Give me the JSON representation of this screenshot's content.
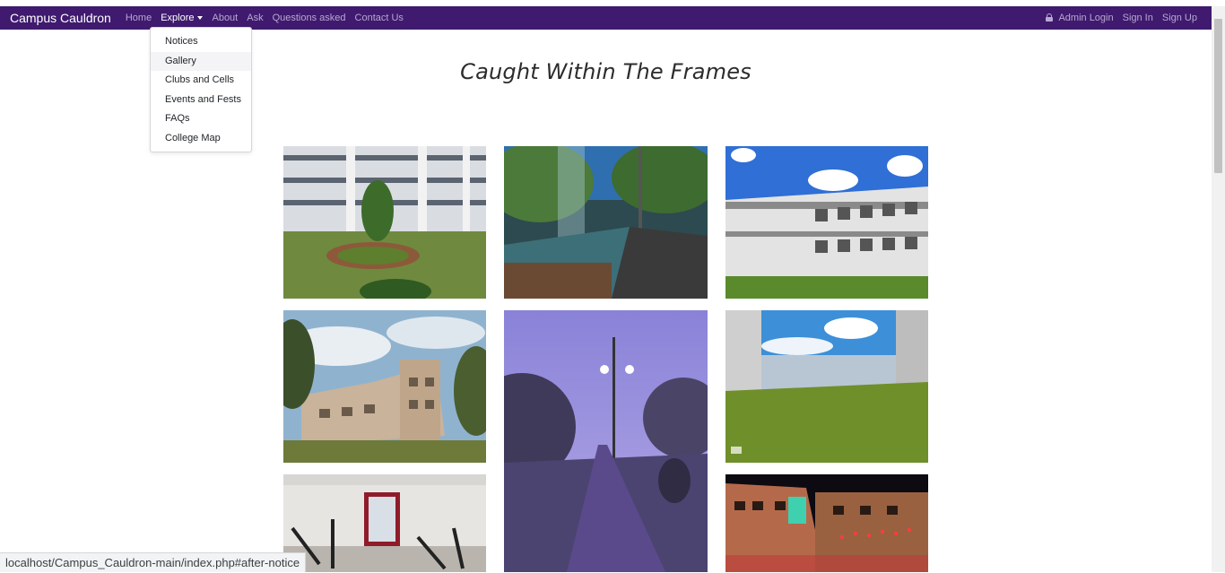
{
  "navbar": {
    "brand": "Campus Cauldron",
    "links": [
      {
        "label": "Home"
      },
      {
        "label": "Explore"
      },
      {
        "label": "About"
      },
      {
        "label": "Ask"
      },
      {
        "label": "Questions asked"
      },
      {
        "label": "Contact Us"
      }
    ],
    "right_links": [
      {
        "label": "Admin Login",
        "icon": "lock-icon"
      },
      {
        "label": "Sign In"
      },
      {
        "label": "Sign Up"
      }
    ],
    "colors": {
      "background": "#3f1a6e",
      "link": "#b9a7d3",
      "active": "#ffffff"
    }
  },
  "dropdown": {
    "items": [
      {
        "label": "Notices"
      },
      {
        "label": "Gallery"
      },
      {
        "label": "Clubs and Cells"
      },
      {
        "label": "Events and Fests"
      },
      {
        "label": "FAQs"
      },
      {
        "label": "College Map"
      }
    ],
    "hovered": "Gallery"
  },
  "gallery": {
    "title": "Caught Within The Frames",
    "photos": [
      {
        "subject": "college courtyard with garden"
      },
      {
        "subject": "campus road with fountain"
      },
      {
        "subject": "college building under blue sky"
      },
      {
        "subject": "college building with cloudy sky"
      },
      {
        "subject": "road with street lights at dusk"
      },
      {
        "subject": "campus lawn with buildings"
      },
      {
        "subject": "gym with exercise machines"
      },
      {
        "subject": "college building lit at night"
      }
    ]
  },
  "status_bar": {
    "url": "localhost/Campus_Cauldron-main/index.php#after-notice"
  }
}
